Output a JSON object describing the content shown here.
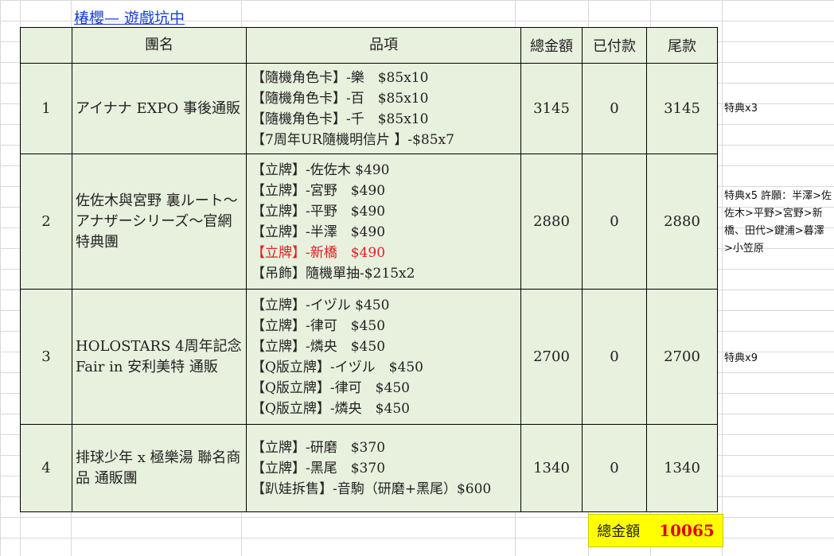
{
  "title": "椿櫻— 遊戲坑中",
  "headers": [
    "團名",
    "品項",
    "總金額",
    "已付款",
    "尾款"
  ],
  "rows": [
    {
      "no": "1",
      "name": "アイナナ EXPO 事後通販",
      "items": [
        {
          "text": "【隨機角色卡】-樂　$85x10",
          "highlight": false
        },
        {
          "text": "【隨機角色卡】-百　$85x10",
          "highlight": false
        },
        {
          "text": "【隨機角色卡】-千　$85x10",
          "highlight": false
        },
        {
          "text": "【7周年UR隨機明信片 】-$85x7",
          "highlight": false
        }
      ],
      "total": "3145",
      "paid": "0",
      "balance": "3145",
      "note": "特典x3"
    },
    {
      "no": "2",
      "name": "佐佐木與宮野 裏ルート～アナザーシリーズ～官網特典團",
      "items": [
        {
          "text": "【立牌】-佐佐木 $490",
          "highlight": false
        },
        {
          "text": "【立牌】-宮野　$490",
          "highlight": false
        },
        {
          "text": "【立牌】-平野　$490",
          "highlight": false
        },
        {
          "text": "【立牌】-半澤　$490",
          "highlight": false
        },
        {
          "text": "【立牌】-新橋　$490",
          "highlight": true
        },
        {
          "text": "【吊飾】隨機單抽-$215x2",
          "highlight": false
        }
      ],
      "total": "2880",
      "paid": "0",
      "balance": "2880",
      "note": "特典x5 許願：半澤>佐佐木>平野>宮野>新橋、田代>鍵浦>暮澤>小笠原"
    },
    {
      "no": "3",
      "name": "HOLOSTARS 4周年記念 Fair in 安利美特 通販",
      "items": [
        {
          "text": "【立牌】-イヅル $450",
          "highlight": false
        },
        {
          "text": "【立牌】-律可　$450",
          "highlight": false
        },
        {
          "text": "【立牌】-燐央　$450",
          "highlight": false
        },
        {
          "text": "【Q版立牌】-イヅル　$450",
          "highlight": false
        },
        {
          "text": "【Q版立牌】-律可　$450",
          "highlight": false
        },
        {
          "text": "【Q版立牌】-燐央　$450",
          "highlight": false
        }
      ],
      "total": "2700",
      "paid": "0",
      "balance": "2700",
      "note": "特典x9"
    },
    {
      "no": "4",
      "name": "排球少年 x 極樂湯 聯名商品 通販團",
      "items": [
        {
          "text": "【立牌】-研磨　$370",
          "highlight": false
        },
        {
          "text": "【立牌】-黑尾　$370",
          "highlight": false
        },
        {
          "text": "【趴娃拆售】-音駒（研磨+黑尾）$600",
          "highlight": false
        }
      ],
      "total": "1340",
      "paid": "0",
      "balance": "1340",
      "note": ""
    }
  ],
  "summary": {
    "label": "總金額",
    "value": "10065"
  },
  "colors": {
    "row_bg": "#e8f0de",
    "highlight_text": "#e02020",
    "summary_bg": "#ffff00",
    "link": "#1a3fcf"
  }
}
